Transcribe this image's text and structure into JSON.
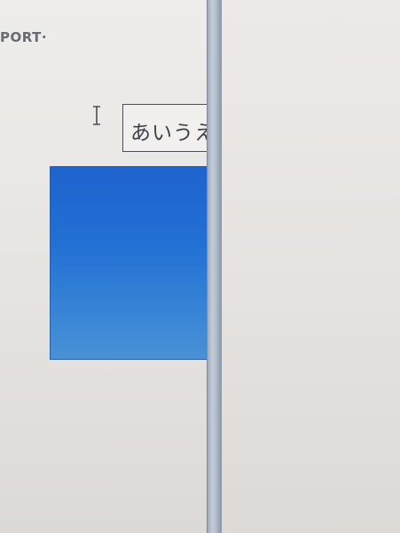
{
  "header": {
    "label": "PORT·"
  },
  "text_box": {
    "value": "あいうえ"
  },
  "icons": {
    "cursor": "text-cursor-ibeam"
  },
  "colors": {
    "shape_fill": "#2270d3",
    "shape_border": "#2b5fa8",
    "text_box_border": "#4b4f55",
    "divider": "#b6c0ce"
  }
}
